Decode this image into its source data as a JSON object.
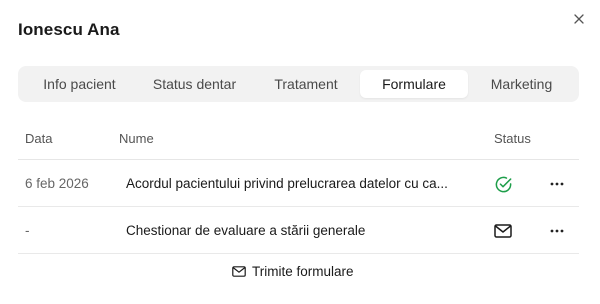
{
  "patient_name": "Ionescu Ana",
  "tabs": [
    {
      "label": "Info pacient",
      "active": false
    },
    {
      "label": "Status dentar",
      "active": false
    },
    {
      "label": "Tratament",
      "active": false
    },
    {
      "label": "Formulare",
      "active": true
    },
    {
      "label": "Marketing",
      "active": false
    }
  ],
  "table": {
    "headers": {
      "date": "Data",
      "name": "Nume",
      "status": "Status"
    },
    "rows": [
      {
        "date": "6 feb 2026",
        "name": "Acordul pacientului privind prelucrarea datelor cu ca...",
        "status_icon": "check-circle-icon",
        "status_color": "#1e9e4a"
      },
      {
        "date": "-",
        "name": "Chestionar de evaluare a stării generale",
        "status_icon": "mail-icon",
        "status_color": "#1a1a1a"
      }
    ]
  },
  "send_button_label": "Trimite formulare",
  "icons": {
    "close": "close-icon",
    "more": "more-horizontal-icon",
    "send": "mail-icon"
  }
}
